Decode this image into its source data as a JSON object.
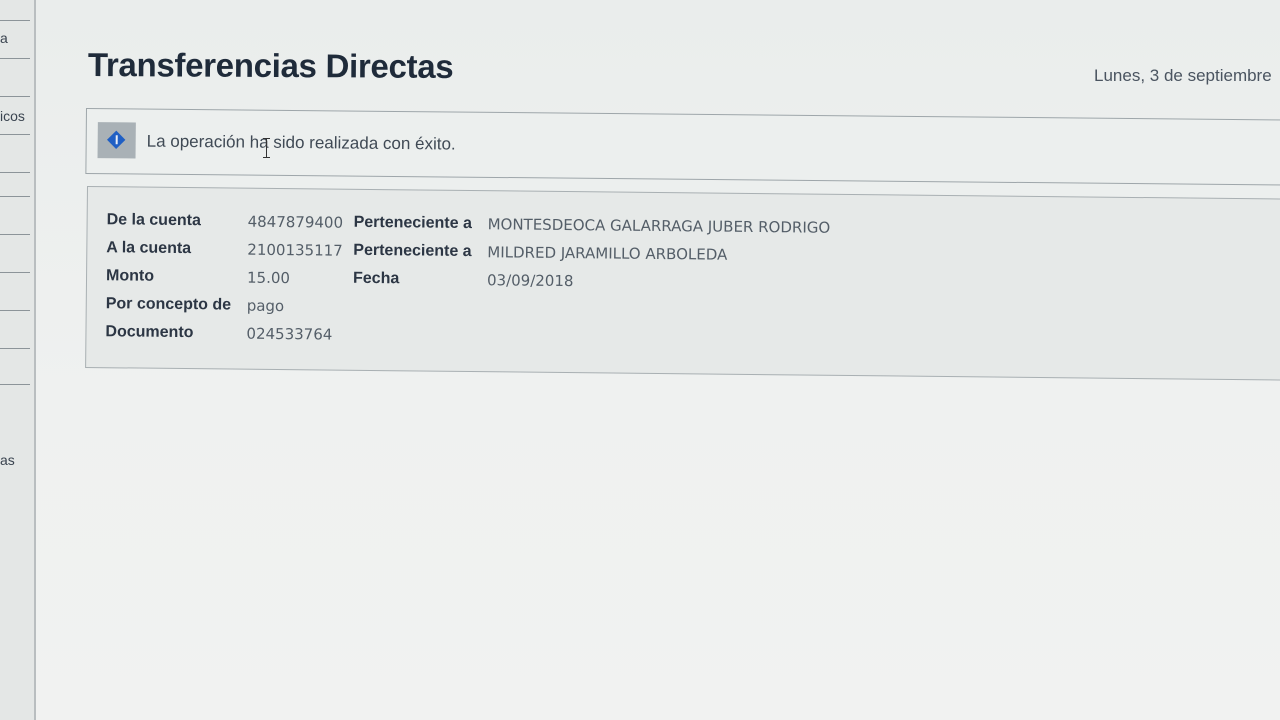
{
  "sidebar": {
    "items": [
      {
        "label": "a"
      },
      {
        "label": "icos"
      },
      {
        "label": "as"
      }
    ]
  },
  "header": {
    "title": "Transferencias Directas",
    "date": "Lunes, 3 de septiembre"
  },
  "notice": {
    "icon": "info-diamond-icon",
    "message": "La operación ha sido realizada con éxito."
  },
  "details": {
    "from_account_label": "De la cuenta",
    "from_account_value": "4847879400",
    "from_owner_label": "Perteneciente a",
    "from_owner_value": "MONTESDEOCA GALARRAGA JUBER RODRIGO",
    "to_account_label": "A la cuenta",
    "to_account_value": "2100135117",
    "to_owner_label": "Perteneciente a",
    "to_owner_value": "MILDRED JARAMILLO ARBOLEDA",
    "amount_label": "Monto",
    "amount_value": "15.00",
    "date_label": "Fecha",
    "date_value": "03/09/2018",
    "concept_label": "Por concepto de",
    "concept_value": "pago",
    "document_label": "Documento",
    "document_value": "024533764"
  },
  "colors": {
    "accent": "#1f5fc4",
    "title": "#1f2b3a",
    "top_strip": "#e0a53a"
  }
}
